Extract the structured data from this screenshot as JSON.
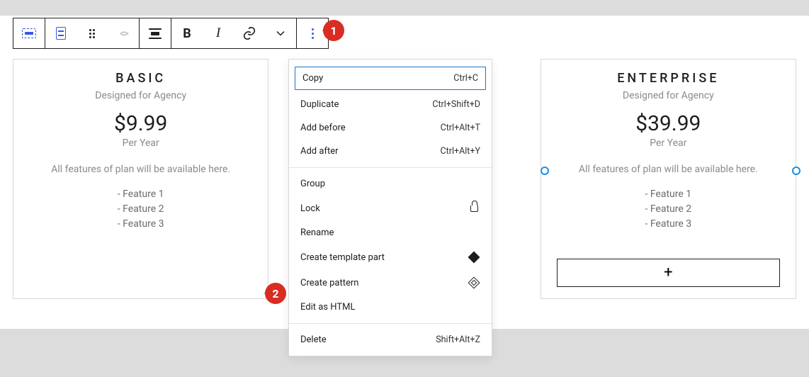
{
  "toolbar": {
    "bold": "B",
    "italic": "I"
  },
  "badges": {
    "one": "1",
    "two": "2"
  },
  "plans": {
    "basic": {
      "name": "BASIC",
      "subtitle": "Designed for Agency",
      "price": "$9.99",
      "period": "Per Year",
      "desc": "All features of plan will be available here.",
      "feature1": "- Feature 1",
      "feature2": "- Feature 2",
      "feature3": "- Feature 3"
    },
    "enterprise": {
      "name": "ENTERPRISE",
      "subtitle": "Designed for Agency",
      "price": "$39.99",
      "period": "Per Year",
      "desc": "All features of plan will be available here.",
      "feature1": "- Feature 1",
      "feature2": "- Feature 2",
      "feature3": "- Feature 3",
      "add_label": "+"
    }
  },
  "menu": {
    "copy": {
      "label": "Copy",
      "shortcut": "Ctrl+C"
    },
    "duplicate": {
      "label": "Duplicate",
      "shortcut": "Ctrl+Shift+D"
    },
    "add_before": {
      "label": "Add before",
      "shortcut": "Ctrl+Alt+T"
    },
    "add_after": {
      "label": "Add after",
      "shortcut": "Ctrl+Alt+Y"
    },
    "group": {
      "label": "Group"
    },
    "lock": {
      "label": "Lock"
    },
    "rename": {
      "label": "Rename"
    },
    "create_template_part": {
      "label": "Create template part"
    },
    "create_pattern": {
      "label": "Create pattern"
    },
    "edit_as_html": {
      "label": "Edit as HTML"
    },
    "delete": {
      "label": "Delete",
      "shortcut": "Shift+Alt+Z"
    }
  }
}
